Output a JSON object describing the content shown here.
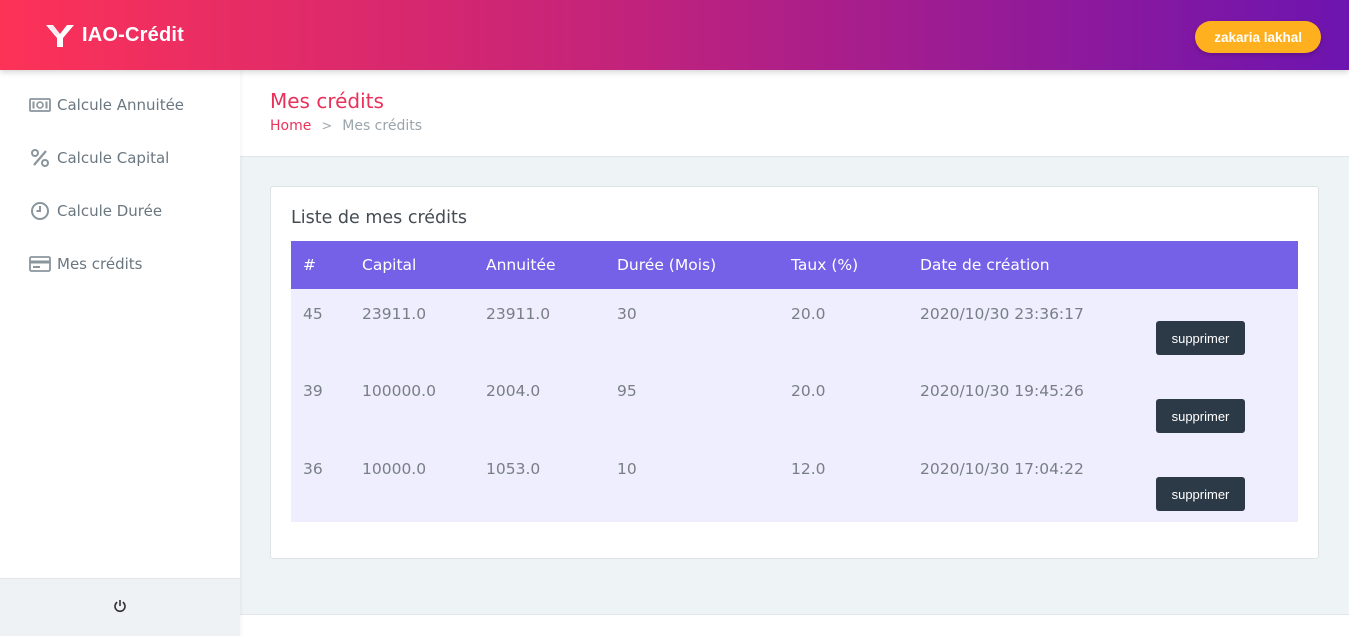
{
  "brand": {
    "name": "IAO-Crédit",
    "logo_icon": "y-logo-icon"
  },
  "user": {
    "name": "zakaria lakhal"
  },
  "colors": {
    "accent": "#e8315b",
    "header_bg": "#7461e8",
    "user_btn": "#ffb01f",
    "delete_btn": "#2c3a47"
  },
  "sidebar": {
    "items": [
      {
        "label": "Calcule Annuitée",
        "icon": "banknote-icon"
      },
      {
        "label": "Calcule Capital",
        "icon": "percent-icon"
      },
      {
        "label": "Calcule Durée",
        "icon": "clock-icon"
      },
      {
        "label": "Mes crédits",
        "icon": "credit-card-icon"
      }
    ],
    "footer_icon": "power-icon"
  },
  "page": {
    "title": "Mes crédits",
    "breadcrumb": {
      "home": "Home",
      "separator": ">",
      "current": "Mes crédits"
    }
  },
  "card": {
    "title": "Liste de mes crédits",
    "columns": [
      "#",
      "Capital",
      "Annuitée",
      "Durée (Mois)",
      "Taux (%)",
      "Date de création"
    ],
    "rows": [
      {
        "id": "45",
        "capital": "23911.0",
        "annuite": "23911.0",
        "duree": "30",
        "taux": "20.0",
        "date": "2020/10/30 23:36:17",
        "action": "supprimer"
      },
      {
        "id": "39",
        "capital": "100000.0",
        "annuite": "2004.0",
        "duree": "95",
        "taux": "20.0",
        "date": "2020/10/30 19:45:26",
        "action": "supprimer"
      },
      {
        "id": "36",
        "capital": "10000.0",
        "annuite": "1053.0",
        "duree": "10",
        "taux": "12.0",
        "date": "2020/10/30 17:04:22",
        "action": "supprimer"
      }
    ]
  }
}
